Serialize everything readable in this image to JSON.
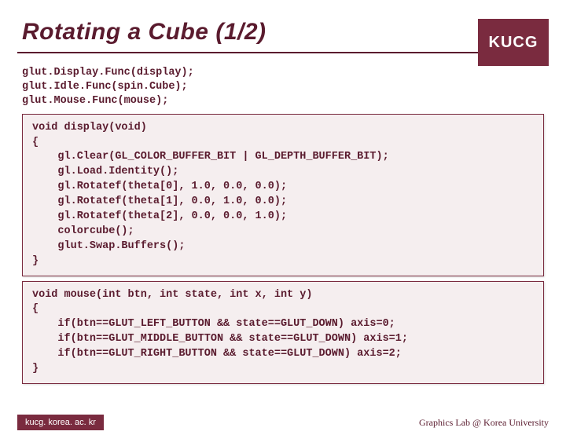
{
  "header": {
    "title": "Rotating a Cube (1/2)",
    "badge": "KUCG"
  },
  "intro_code": "glut.Display.Func(display);\nglut.Idle.Func(spin.Cube);\nglut.Mouse.Func(mouse);",
  "code_block_1": "void display(void)\n{\n    gl.Clear(GL_COLOR_BUFFER_BIT | GL_DEPTH_BUFFER_BIT);\n    gl.Load.Identity();\n    gl.Rotatef(theta[0], 1.0, 0.0, 0.0);\n    gl.Rotatef(theta[1], 0.0, 1.0, 0.0);\n    gl.Rotatef(theta[2], 0.0, 0.0, 1.0);\n    colorcube();\n    glut.Swap.Buffers();\n}",
  "code_block_2": "void mouse(int btn, int state, int x, int y)\n{\n    if(btn==GLUT_LEFT_BUTTON && state==GLUT_DOWN) axis=0;\n    if(btn==GLUT_MIDDLE_BUTTON && state==GLUT_DOWN) axis=1;\n    if(btn==GLUT_RIGHT_BUTTON && state==GLUT_DOWN) axis=2;\n}",
  "footer": {
    "left": "kucg. korea. ac. kr",
    "right": "Graphics Lab @ Korea University"
  }
}
